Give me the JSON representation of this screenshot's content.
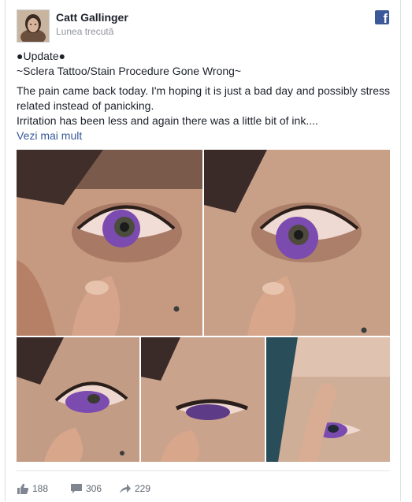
{
  "post": {
    "author": "Catt Gallinger",
    "time": "Lunea trecută",
    "platform_icon": "facebook-icon",
    "lines": [
      "●Update●",
      "~Sclera Tattoo/Stain Procedure Gone Wrong~",
      "The pain came back today. I'm hoping it is just a bad day and possibly stress related instead of panicking.",
      "Irritation has been less and again there was a little bit of ink...."
    ],
    "see_more": "Vezi mai mult"
  },
  "photos": [
    {
      "name": "eye-photo-1"
    },
    {
      "name": "eye-photo-2"
    },
    {
      "name": "eye-photo-3"
    },
    {
      "name": "eye-photo-4"
    },
    {
      "name": "eye-photo-5"
    }
  ],
  "stats": {
    "likes": "188",
    "comments": "306",
    "shares": "229"
  },
  "colors": {
    "link": "#365899",
    "facebook_blue": "#3b5998",
    "iris_stain": "#7b4bb0"
  }
}
